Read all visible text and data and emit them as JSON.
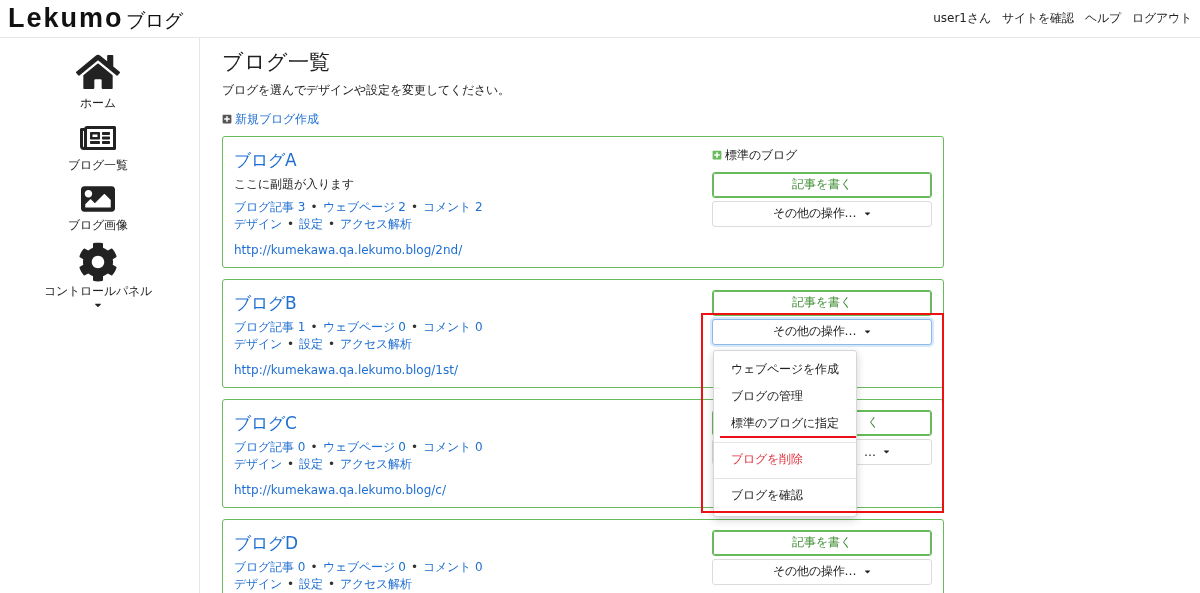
{
  "header": {
    "logo": "Lekumo",
    "logo_suffix": "ブログ",
    "nav": [
      "user1さん",
      "サイトを確認",
      "ヘルプ",
      "ログアウト"
    ]
  },
  "sidebar": {
    "items": [
      {
        "kind": "home",
        "label": "ホーム"
      },
      {
        "kind": "list",
        "label": "ブログ一覧"
      },
      {
        "kind": "image",
        "label": "ブログ画像"
      },
      {
        "kind": "settings",
        "label": "コントロールパネル",
        "expandable": true
      }
    ]
  },
  "page": {
    "title": "ブログ一覧",
    "description": "ブログを選んでデザインや設定を変更してください。",
    "new_link": "新規ブログ作成"
  },
  "blogs": [
    {
      "title": "ブログA",
      "subtitle": "ここに副題が入ります",
      "default": true,
      "default_label": "標準のブログ",
      "stats": [
        "ブログ記事 3",
        "•",
        "ウェブページ 2",
        "•",
        "コメント 2"
      ],
      "links": [
        "デザイン",
        "•",
        "設定",
        "•",
        "アクセス解析"
      ],
      "url": "http://kumekawa.qa.lekumo.blog/2nd/",
      "write_button": "記事を書く",
      "ops_button": "その他の操作…",
      "menu_open": false
    },
    {
      "title": "ブログB",
      "default": false,
      "stats": [
        "ブログ記事 1",
        "•",
        "ウェブページ 0",
        "•",
        "コメント 0"
      ],
      "links": [
        "デザイン",
        "•",
        "設定",
        "•",
        "アクセス解析"
      ],
      "url": "http://kumekawa.qa.lekumo.blog/1st/",
      "write_button": "記事を書く",
      "ops_button": "その他の操作…",
      "menu_open": true,
      "highlighted": true,
      "menu": [
        {
          "kind": "item",
          "label": "ウェブページを作成",
          "underlined": false
        },
        {
          "kind": "item",
          "label": "ブログの管理",
          "underlined": false
        },
        {
          "kind": "item",
          "label": "標準のブログに指定",
          "underlined": true
        },
        {
          "kind": "danger",
          "label": "ブログを削除",
          "underlined": false
        },
        {
          "kind": "item",
          "label": "ブログを確認",
          "underlined": false
        }
      ]
    },
    {
      "title": "ブログC",
      "default": false,
      "stats": [
        "ブログ記事 0",
        "•",
        "ウェブページ 0",
        "•",
        "コメント 0"
      ],
      "links": [
        "デザイン",
        "•",
        "設定",
        "•",
        "アクセス解析"
      ],
      "url": "http://kumekawa.qa.lekumo.blog/c/",
      "write_button": "く",
      "ops_button": "…",
      "menu_open": false,
      "obscured": true
    },
    {
      "title": "ブログD",
      "default": false,
      "stats": [
        "ブログ記事 0",
        "•",
        "ウェブページ 0",
        "•",
        "コメント 0"
      ],
      "links": [
        "デザイン",
        "•",
        "設定",
        "•",
        "アクセス解析"
      ],
      "write_button": "記事を書く",
      "ops_button": "その他の操作…",
      "menu_open": false
    }
  ]
}
